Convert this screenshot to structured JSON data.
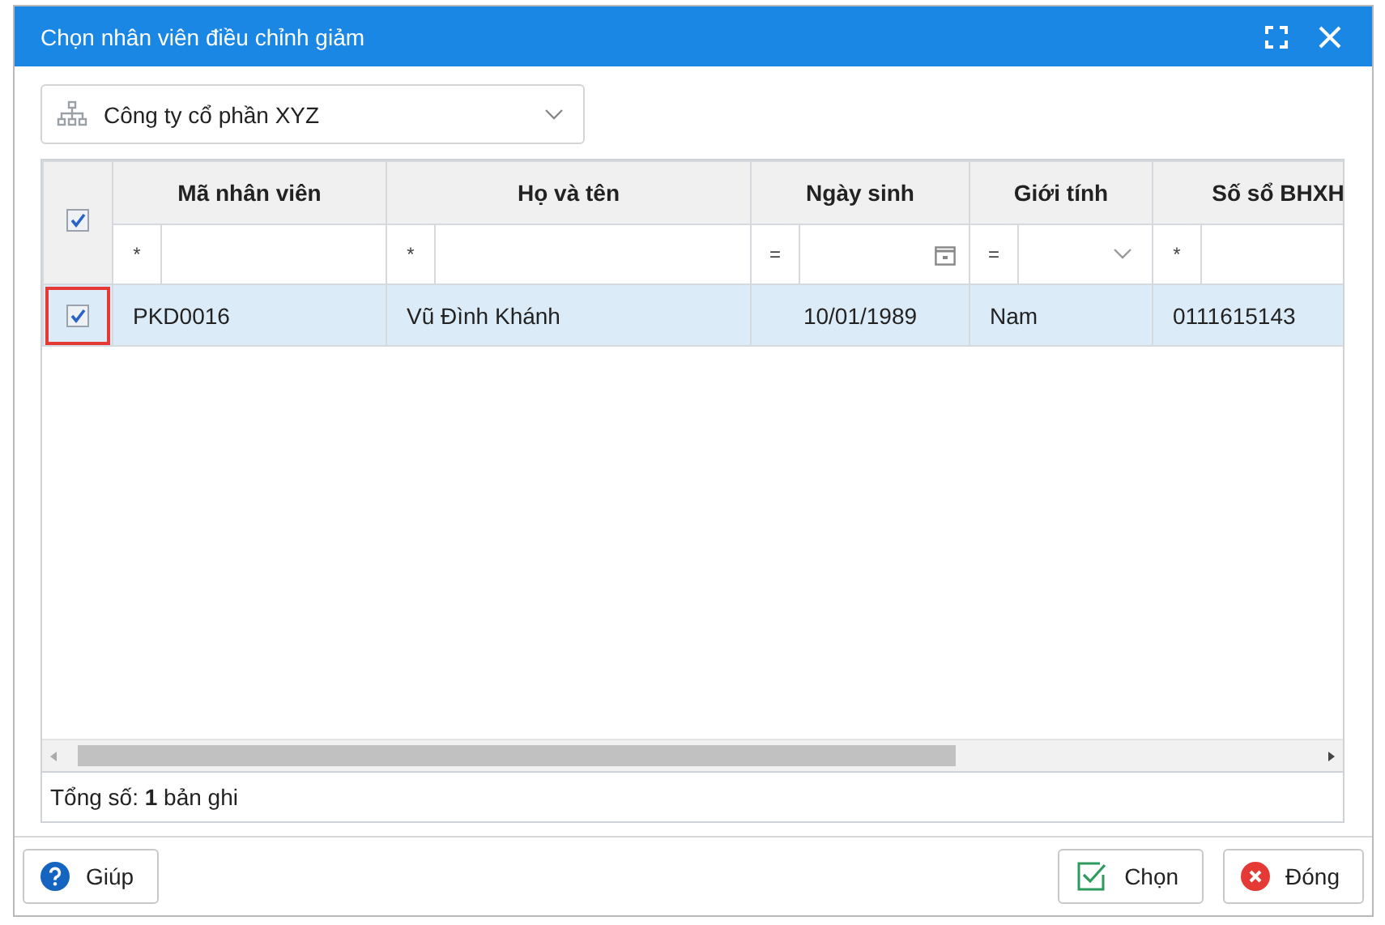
{
  "window": {
    "title": "Chọn nhân viên điều chỉnh giảm"
  },
  "company": {
    "value": "Công ty cổ phần XYZ"
  },
  "grid": {
    "all_checked": true,
    "columns": [
      {
        "label": "Mã nhân viên",
        "filter": {
          "kind": "text",
          "op": "*"
        }
      },
      {
        "label": "Họ và tên",
        "filter": {
          "kind": "text",
          "op": "*"
        }
      },
      {
        "label": "Ngày sinh",
        "filter": {
          "kind": "date",
          "op": "="
        }
      },
      {
        "label": "Giới tính",
        "filter": {
          "kind": "select",
          "op": "="
        }
      },
      {
        "label": "Số sổ BHXH",
        "filter": {
          "kind": "text",
          "op": "*"
        }
      }
    ],
    "rows": [
      {
        "checked": true,
        "selected": true,
        "highlighted": true,
        "cells": [
          "PKD0016",
          "Vũ Đình Khánh",
          "10/01/1989",
          "Nam",
          "0111615143"
        ]
      }
    ],
    "total": "Tổng số: **1** bản ghi"
  },
  "buttons": [
    {
      "kind": "help",
      "label": "Giúp"
    },
    {
      "kind": "choose",
      "label": "Chọn"
    },
    {
      "kind": "close",
      "label": "Đóng"
    }
  ]
}
